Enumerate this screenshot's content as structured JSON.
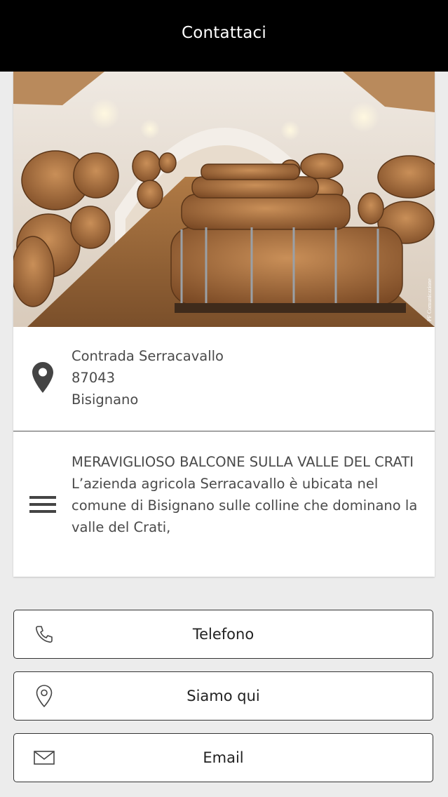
{
  "header": {
    "title": "Contattaci"
  },
  "hero": {
    "image": "wine-cellar-barrels-photo",
    "watermark": "PF Comunicazione"
  },
  "address": {
    "icon": "map-pin-icon",
    "line1": "Contrada Serracavallo",
    "line2": "87043",
    "line3": "Bisignano"
  },
  "description": {
    "icon": "menu-lines-icon",
    "title": "MERAVIGLIOSO BALCONE SULLA VALLE DEL CRATI",
    "body": "L’azienda agricola Serracavallo è ubicata nel comune di Bisignano sulle colline che dominano la valle del Crati,"
  },
  "buttons": {
    "phone": {
      "label": "Telefono",
      "icon": "phone-icon"
    },
    "location": {
      "label": "Siamo qui",
      "icon": "location-pin-icon"
    },
    "email": {
      "label": "Email",
      "icon": "envelope-icon"
    }
  },
  "colors": {
    "header_bg": "#000000",
    "page_bg": "#ececec",
    "text": "#4a4a4a"
  }
}
